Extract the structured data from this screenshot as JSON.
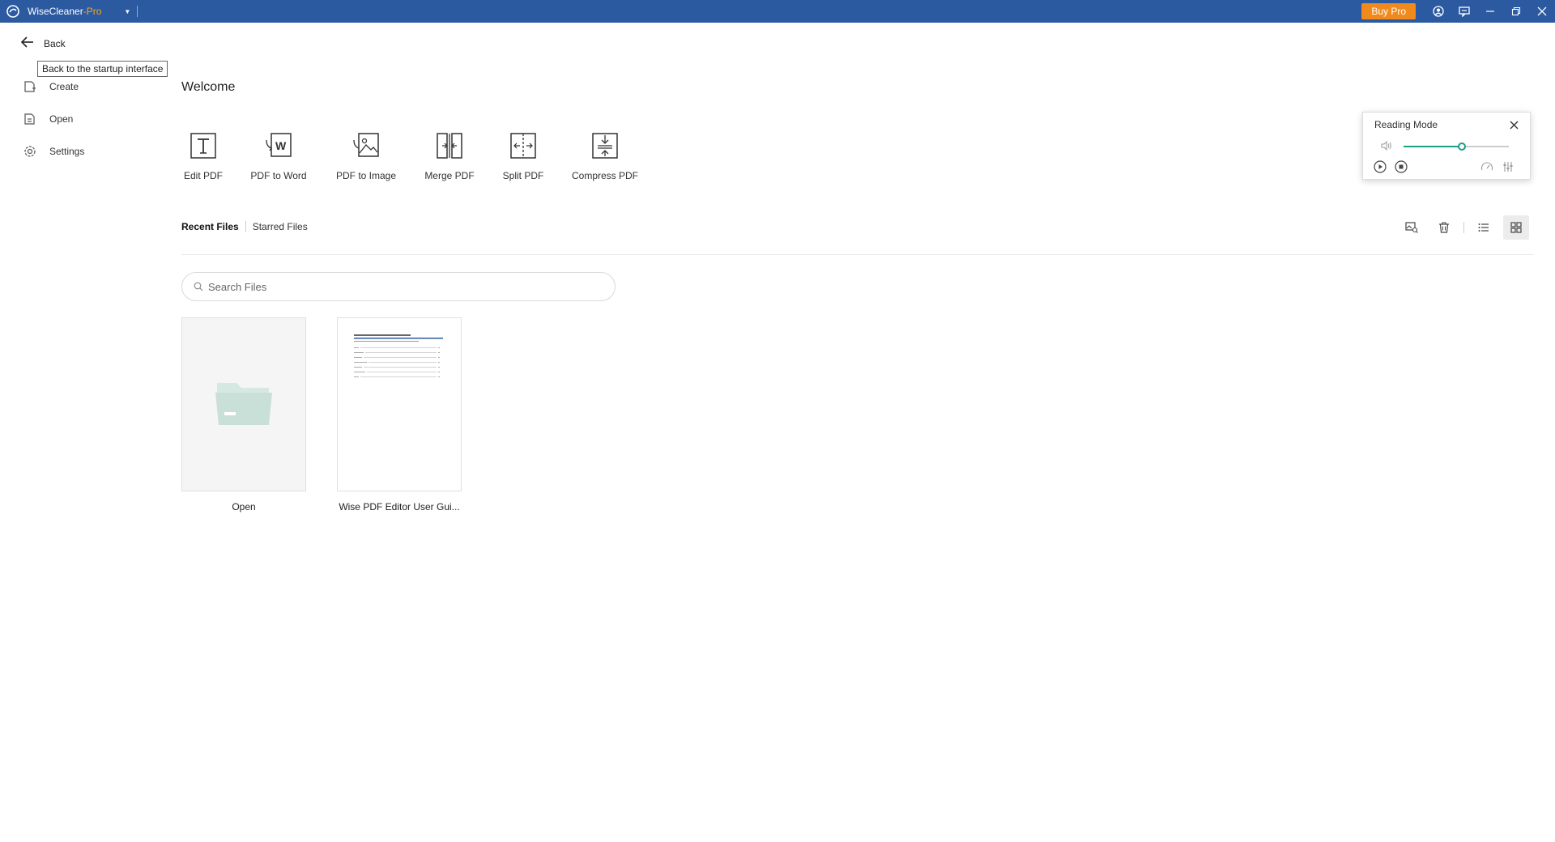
{
  "titlebar": {
    "app_name": "WiseCleaner",
    "app_suffix": "-Pro",
    "buy_pro_label": "Buy Pro"
  },
  "sidebar": {
    "back_label": "Back",
    "back_tooltip": "Back to the startup interface",
    "items": [
      {
        "label": "Create",
        "icon": "create-file-icon"
      },
      {
        "label": "Open",
        "icon": "open-file-icon"
      },
      {
        "label": "Settings",
        "icon": "gear-icon"
      }
    ]
  },
  "main": {
    "welcome": "Welcome",
    "tools": [
      {
        "label": "Edit PDF",
        "icon": "edit-pdf-icon"
      },
      {
        "label": "PDF to Word",
        "icon": "pdf-to-word-icon"
      },
      {
        "label": "PDF to Image",
        "icon": "pdf-to-image-icon"
      },
      {
        "label": "Merge PDF",
        "icon": "merge-pdf-icon"
      },
      {
        "label": "Split PDF",
        "icon": "split-pdf-icon"
      },
      {
        "label": "Compress PDF",
        "icon": "compress-pdf-icon"
      }
    ],
    "tabs": [
      {
        "label": "Recent Files",
        "active": true
      },
      {
        "label": "Starred Files",
        "active": false
      }
    ],
    "search": {
      "placeholder": "Search Files",
      "value": ""
    },
    "files": [
      {
        "name": "Open"
      },
      {
        "name": "Wise PDF Editor User Gui..."
      }
    ]
  },
  "reading_mode": {
    "title": "Reading Mode",
    "volume": 0.55,
    "accent_color": "#16a085"
  },
  "colors": {
    "titlebar": "#2c5aa0",
    "buy_pro": "#f08a1c",
    "pro_text": "#f5a623",
    "folder": "#c8e0d8"
  }
}
